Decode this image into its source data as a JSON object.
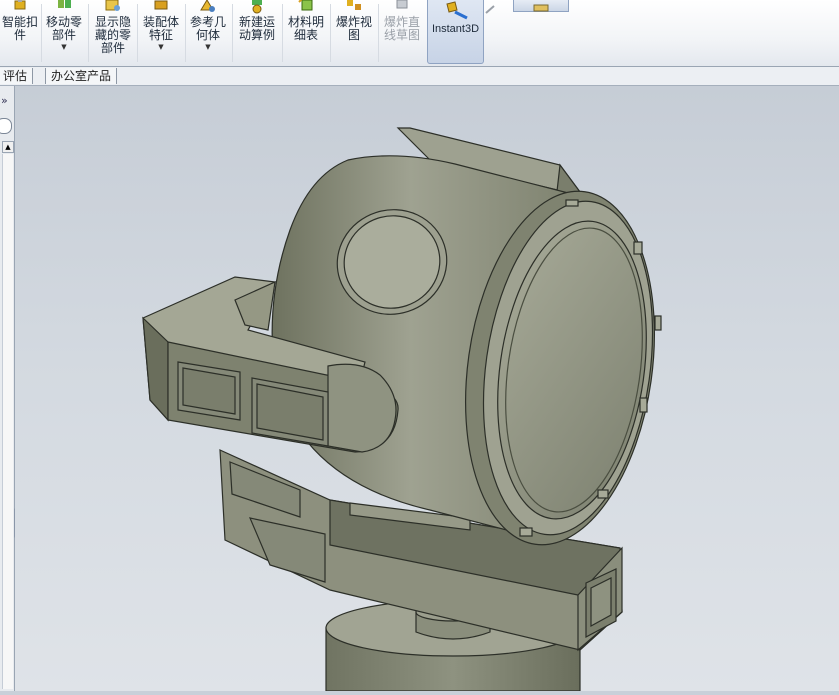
{
  "ribbon": {
    "buttons": [
      {
        "name": "smart-fastener",
        "label": "智能扣\n件",
        "dropdown": false,
        "disabled": false
      },
      {
        "name": "move-component",
        "label": "移动零\n部件",
        "dropdown": true,
        "disabled": false
      },
      {
        "name": "show-hidden-components",
        "label": "显示隐\n藏的零\n部件",
        "dropdown": false,
        "disabled": false
      },
      {
        "name": "assembly-features",
        "label": "装配体\n特征",
        "dropdown": true,
        "disabled": false
      },
      {
        "name": "reference-geometry",
        "label": "参考几\n何体",
        "dropdown": true,
        "disabled": false
      },
      {
        "name": "new-motion-study",
        "label": "新建运\n动算例",
        "dropdown": false,
        "disabled": false
      },
      {
        "name": "bill-of-materials",
        "label": "材料明\n细表",
        "dropdown": false,
        "disabled": false
      },
      {
        "name": "exploded-view",
        "label": "爆炸视\n图",
        "dropdown": false,
        "disabled": false
      },
      {
        "name": "explode-line-sketch",
        "label": "爆炸直\n线草图",
        "dropdown": false,
        "disabled": true
      }
    ],
    "instant3d_label": "Instant3D",
    "dropdown_glyph": "▼"
  },
  "tabs": [
    "评估",
    "办公室产品"
  ],
  "left_panel": {
    "expand_glyph": "»",
    "scroll_up_glyph": "▲",
    "collapse_glyph": "◂\n◂"
  },
  "icons": {
    "smart-fastener": "bolt-icon",
    "move-component": "move-component-icon",
    "show-hidden-components": "show-hidden-icon",
    "assembly-features": "assembly-feature-icon",
    "reference-geometry": "reference-geometry-icon",
    "new-motion-study": "motion-study-icon",
    "bill-of-materials": "bom-icon",
    "exploded-view": "exploded-view-icon",
    "explode-line-sketch": "explode-line-icon",
    "instant3d": "instant3d-icon"
  },
  "colors": {
    "model_fill": "#8e9180",
    "model_light": "#b6b8a6",
    "model_dark": "#555a4a",
    "edge": "#2c2f28",
    "viewport_bg": "#c9d0d9"
  }
}
